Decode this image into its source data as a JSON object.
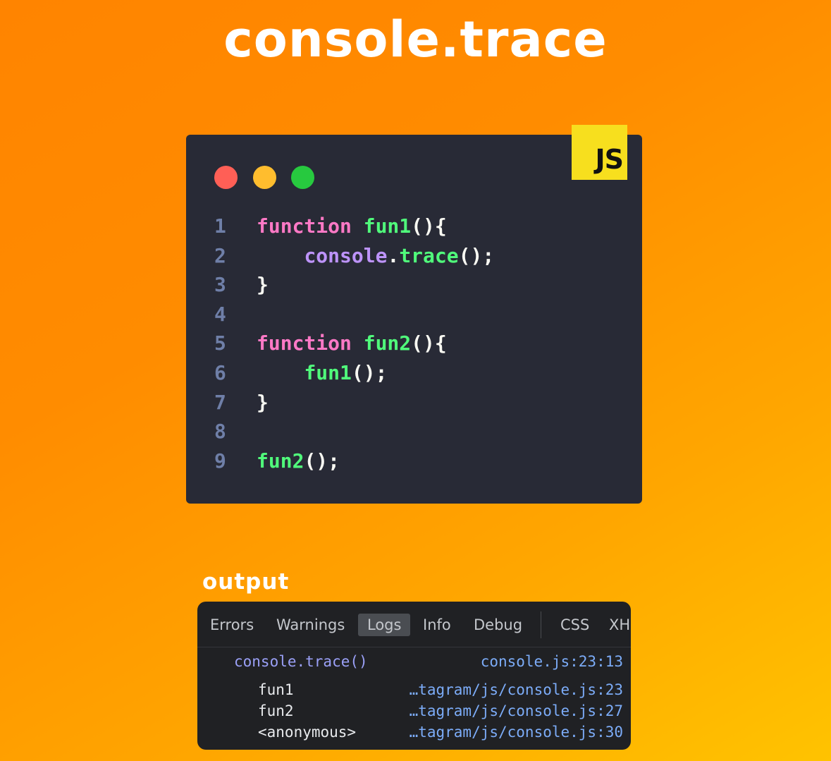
{
  "page": {
    "title": "console.trace",
    "output_label": "output"
  },
  "editor": {
    "badge": "JS",
    "window_dots": [
      "red-dot",
      "yellow-dot",
      "green-dot"
    ],
    "lines": [
      {
        "num": "1",
        "tokens": [
          [
            "kw",
            "function"
          ],
          [
            "plain",
            " "
          ],
          [
            "fn",
            "fun1"
          ],
          [
            "punc",
            "(){"
          ]
        ]
      },
      {
        "num": "2",
        "tokens": [
          [
            "plain",
            "    "
          ],
          [
            "obj",
            "console"
          ],
          [
            "punc",
            "."
          ],
          [
            "fn",
            "trace"
          ],
          [
            "punc",
            "();"
          ]
        ]
      },
      {
        "num": "3",
        "tokens": [
          [
            "punc",
            "}"
          ]
        ]
      },
      {
        "num": "4",
        "tokens": []
      },
      {
        "num": "5",
        "tokens": [
          [
            "kw",
            "function"
          ],
          [
            "plain",
            " "
          ],
          [
            "fn",
            "fun2"
          ],
          [
            "punc",
            "(){"
          ]
        ]
      },
      {
        "num": "6",
        "tokens": [
          [
            "plain",
            "    "
          ],
          [
            "fn",
            "fun1"
          ],
          [
            "punc",
            "();"
          ]
        ]
      },
      {
        "num": "7",
        "tokens": [
          [
            "punc",
            "}"
          ]
        ]
      },
      {
        "num": "8",
        "tokens": []
      },
      {
        "num": "9",
        "tokens": [
          [
            "fn",
            "fun2"
          ],
          [
            "punc",
            "();"
          ]
        ]
      }
    ]
  },
  "console": {
    "tabs": [
      {
        "label": "Errors",
        "active": false
      },
      {
        "label": "Warnings",
        "active": false
      },
      {
        "label": "Logs",
        "active": true
      },
      {
        "label": "Info",
        "active": false
      },
      {
        "label": "Debug",
        "active": false
      },
      {
        "label": "CSS",
        "active": false
      },
      {
        "label": "XH",
        "active": false
      }
    ],
    "trace_call": "console.trace()",
    "trace_source": "console.js:23:13",
    "frames": [
      {
        "name": "fun1",
        "location": "…tagram/js/console.js:23"
      },
      {
        "name": "fun2",
        "location": "…tagram/js/console.js:27"
      },
      {
        "name": "<anonymous>",
        "location": "…tagram/js/console.js:30"
      }
    ]
  },
  "colors": {
    "keyword": "#ff79c6",
    "function": "#50fa7b",
    "object": "#bd93f9",
    "punctuation": "#f8f8f2",
    "line_number": "#6f7fa8",
    "editor_bg": "#282a36",
    "console_bg": "#202124",
    "link": "#7cacf8",
    "badge_bg": "#f7df1e"
  }
}
